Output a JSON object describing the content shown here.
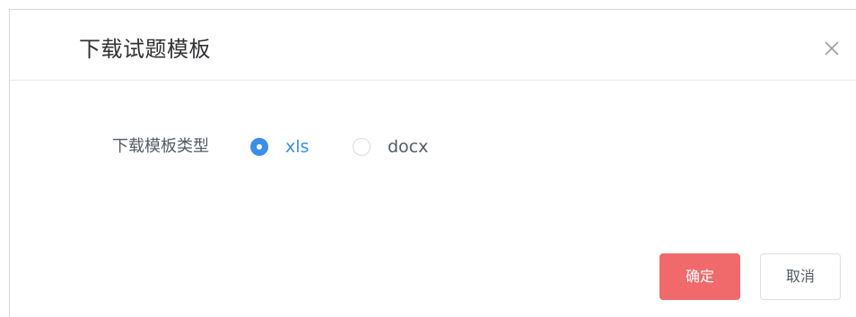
{
  "dialog": {
    "title": "下载试题模板",
    "close_icon": "close-icon"
  },
  "form": {
    "label": "下载模板类型",
    "options": [
      {
        "label": "xls",
        "checked": true
      },
      {
        "label": "docx",
        "checked": false
      }
    ]
  },
  "footer": {
    "confirm_label": "确定",
    "cancel_label": "取消"
  },
  "colors": {
    "primary": "#3a8ee6",
    "confirm": "#f0696b",
    "text": "#555b66",
    "title": "#303133"
  }
}
